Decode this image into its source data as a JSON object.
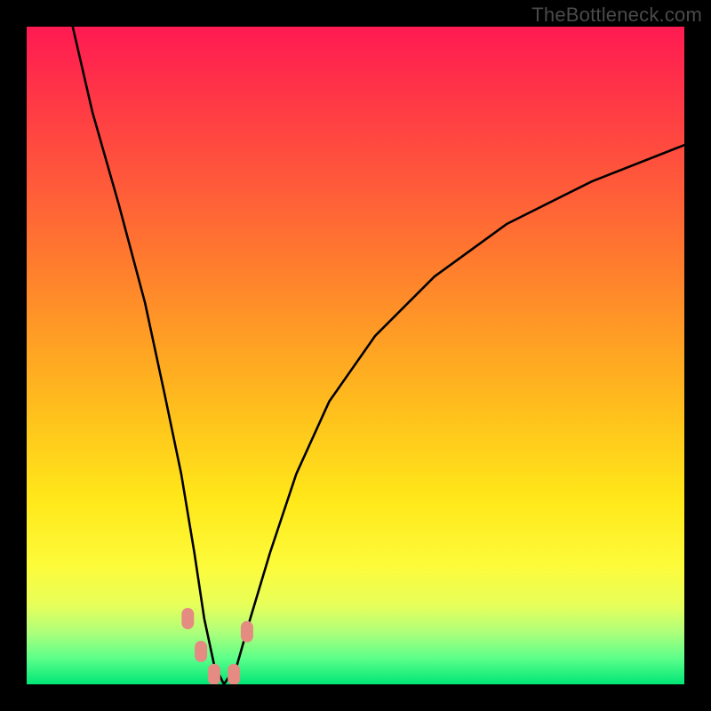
{
  "watermark": "TheBottleneck.com",
  "chart_data": {
    "type": "line",
    "title": "",
    "xlabel": "",
    "ylabel": "",
    "xlim": [
      0,
      100
    ],
    "ylim": [
      0,
      100
    ],
    "series": [
      {
        "name": "bottleneck-curve",
        "x": [
          7,
          10,
          14,
          18,
          21,
          23.5,
          25.5,
          27,
          28.5,
          30,
          32,
          34,
          37,
          41,
          46,
          53,
          62,
          73,
          86,
          100
        ],
        "values": [
          100,
          87,
          73,
          58,
          44,
          32,
          20,
          10,
          3,
          0,
          3,
          10,
          20,
          32,
          43,
          53,
          62,
          70,
          76.5,
          82
        ]
      }
    ],
    "markers": [
      {
        "x": 24.5,
        "y": 10,
        "label": "marker-left-upper"
      },
      {
        "x": 26.5,
        "y": 5,
        "label": "marker-left-mid"
      },
      {
        "x": 28.5,
        "y": 1.5,
        "label": "marker-bottom-left"
      },
      {
        "x": 31.5,
        "y": 1.5,
        "label": "marker-bottom-right"
      },
      {
        "x": 33.5,
        "y": 8,
        "label": "marker-right-upper"
      }
    ],
    "background_gradient": {
      "top": "#ff1a52",
      "mid": "#ffd21a",
      "bottom": "#00e676"
    },
    "frame_color": "#000000"
  }
}
